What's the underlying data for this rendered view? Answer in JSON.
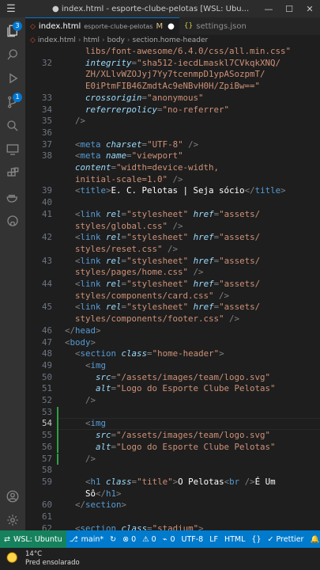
{
  "titlebar": {
    "title": "● index.html - esporte-clube-pelotas [WSL: Ubu...",
    "minimize": "—",
    "maximize": "☐",
    "close": "✕"
  },
  "activity": {
    "scm_badge": "3",
    "extensions_badge": "1"
  },
  "tabs": [
    {
      "label": "index.html",
      "path": "esporte-clube-pelotas",
      "status": "M",
      "dirty": "●"
    },
    {
      "label": "settings.json"
    }
  ],
  "breadcrumb": [
    "index.html",
    "html",
    "body",
    "section.home-header"
  ],
  "code_lines": [
    {
      "n": "",
      "tokens": [
        [
          "p",
          "    "
        ],
        [
          "str",
          "libs/font-awesome/6.4.0/css/all.min.css\""
        ]
      ]
    },
    {
      "n": "32",
      "tokens": [
        [
          "attr",
          "    integrity"
        ],
        [
          "p",
          "="
        ],
        [
          "str",
          "\"sha512-iecdLmaskl7CVkqkXNQ/"
        ]
      ]
    },
    {
      "n": "",
      "tokens": [
        [
          "str",
          "    ZH/XLlvWZOJyj7Yy7tcenmpD1ypASozpmT/"
        ]
      ]
    },
    {
      "n": "",
      "tokens": [
        [
          "str",
          "    E0iPtmFIB46ZmdtAc9eNBvH0H/ZpiBw==\""
        ]
      ]
    },
    {
      "n": "33",
      "tokens": [
        [
          "attr",
          "    crossorigin"
        ],
        [
          "p",
          "="
        ],
        [
          "str",
          "\"anonymous\""
        ]
      ]
    },
    {
      "n": "34",
      "tokens": [
        [
          "attr",
          "    referrerpolicy"
        ],
        [
          "p",
          "="
        ],
        [
          "str",
          "\"no-referrer\""
        ]
      ]
    },
    {
      "n": "35",
      "tokens": [
        [
          "p",
          "  />"
        ]
      ]
    },
    {
      "n": "36",
      "tokens": []
    },
    {
      "n": "37",
      "tokens": [
        [
          "p",
          "  <"
        ],
        [
          "tag",
          "meta"
        ],
        [
          "attr",
          " charset"
        ],
        [
          "p",
          "="
        ],
        [
          "str",
          "\"UTF-8\""
        ],
        [
          "p",
          " />"
        ]
      ]
    },
    {
      "n": "38",
      "tokens": [
        [
          "p",
          "  <"
        ],
        [
          "tag",
          "meta"
        ],
        [
          "attr",
          " name"
        ],
        [
          "p",
          "="
        ],
        [
          "str",
          "\"viewport\""
        ]
      ]
    },
    {
      "n": "",
      "tokens": [
        [
          "attr",
          "  content"
        ],
        [
          "p",
          "="
        ],
        [
          "str",
          "\"width=device-width,"
        ]
      ]
    },
    {
      "n": "",
      "tokens": [
        [
          "str",
          "  initial-scale=1.0\""
        ],
        [
          "p",
          " />"
        ]
      ]
    },
    {
      "n": "39",
      "tokens": [
        [
          "p",
          "  <"
        ],
        [
          "tag",
          "title"
        ],
        [
          "p",
          ">"
        ],
        [
          "g",
          "E. C. Pelotas | Seja sócio"
        ],
        [
          "p",
          "</"
        ],
        [
          "tag",
          "title"
        ],
        [
          "p",
          ">"
        ]
      ]
    },
    {
      "n": "40",
      "tokens": []
    },
    {
      "n": "41",
      "tokens": [
        [
          "p",
          "  <"
        ],
        [
          "tag",
          "link"
        ],
        [
          "attr",
          " rel"
        ],
        [
          "p",
          "="
        ],
        [
          "str",
          "\"stylesheet\""
        ],
        [
          "attr",
          " href"
        ],
        [
          "p",
          "="
        ],
        [
          "str",
          "\"assets/"
        ]
      ]
    },
    {
      "n": "",
      "tokens": [
        [
          "str",
          "  styles/global.css\""
        ],
        [
          "p",
          " />"
        ]
      ]
    },
    {
      "n": "42",
      "tokens": [
        [
          "p",
          "  <"
        ],
        [
          "tag",
          "link"
        ],
        [
          "attr",
          " rel"
        ],
        [
          "p",
          "="
        ],
        [
          "str",
          "\"stylesheet\""
        ],
        [
          "attr",
          " href"
        ],
        [
          "p",
          "="
        ],
        [
          "str",
          "\"assets/"
        ]
      ]
    },
    {
      "n": "",
      "tokens": [
        [
          "str",
          "  styles/reset.css\""
        ],
        [
          "p",
          " />"
        ]
      ]
    },
    {
      "n": "43",
      "tokens": [
        [
          "p",
          "  <"
        ],
        [
          "tag",
          "link"
        ],
        [
          "attr",
          " rel"
        ],
        [
          "p",
          "="
        ],
        [
          "str",
          "\"stylesheet\""
        ],
        [
          "attr",
          " href"
        ],
        [
          "p",
          "="
        ],
        [
          "str",
          "\"assets/"
        ]
      ]
    },
    {
      "n": "",
      "tokens": [
        [
          "str",
          "  styles/pages/home.css\""
        ],
        [
          "p",
          " />"
        ]
      ]
    },
    {
      "n": "44",
      "tokens": [
        [
          "p",
          "  <"
        ],
        [
          "tag",
          "link"
        ],
        [
          "attr",
          " rel"
        ],
        [
          "p",
          "="
        ],
        [
          "str",
          "\"stylesheet\""
        ],
        [
          "attr",
          " href"
        ],
        [
          "p",
          "="
        ],
        [
          "str",
          "\"assets/"
        ]
      ]
    },
    {
      "n": "",
      "tokens": [
        [
          "str",
          "  styles/components/card.css\""
        ],
        [
          "p",
          " />"
        ]
      ]
    },
    {
      "n": "45",
      "tokens": [
        [
          "p",
          "  <"
        ],
        [
          "tag",
          "link"
        ],
        [
          "attr",
          " rel"
        ],
        [
          "p",
          "="
        ],
        [
          "str",
          "\"stylesheet\""
        ],
        [
          "attr",
          " href"
        ],
        [
          "p",
          "="
        ],
        [
          "str",
          "\"assets/"
        ]
      ]
    },
    {
      "n": "",
      "tokens": [
        [
          "str",
          "  styles/components/footer.css\""
        ],
        [
          "p",
          " />"
        ]
      ]
    },
    {
      "n": "46",
      "tokens": [
        [
          "p",
          "</"
        ],
        [
          "tag",
          "head"
        ],
        [
          "p",
          ">"
        ]
      ]
    },
    {
      "n": "47",
      "tokens": [
        [
          "p",
          "<"
        ],
        [
          "tag",
          "body"
        ],
        [
          "p",
          ">"
        ]
      ]
    },
    {
      "n": "48",
      "tokens": [
        [
          "p",
          "  <"
        ],
        [
          "tag",
          "section"
        ],
        [
          "attr",
          " class"
        ],
        [
          "p",
          "="
        ],
        [
          "str",
          "\"home-header\""
        ],
        [
          "p",
          ">"
        ]
      ]
    },
    {
      "n": "49",
      "tokens": [
        [
          "p",
          "    <"
        ],
        [
          "tag",
          "img"
        ]
      ]
    },
    {
      "n": "50",
      "tokens": [
        [
          "attr",
          "      src"
        ],
        [
          "p",
          "="
        ],
        [
          "str",
          "\"/assets/images/team/logo.svg\""
        ]
      ]
    },
    {
      "n": "51",
      "tokens": [
        [
          "attr",
          "      alt"
        ],
        [
          "p",
          "="
        ],
        [
          "str",
          "\"Logo do Esporte Clube Pelotas\""
        ]
      ]
    },
    {
      "n": "52",
      "tokens": [
        [
          "p",
          "    />"
        ]
      ]
    },
    {
      "n": "53",
      "tokens": []
    },
    {
      "n": "54",
      "tokens": [
        [
          "p",
          "    <"
        ],
        [
          "tag",
          "img"
        ]
      ],
      "current": true
    },
    {
      "n": "55",
      "tokens": [
        [
          "attr",
          "      src"
        ],
        [
          "p",
          "="
        ],
        [
          "str",
          "\"/assets/images/team/logo.svg\""
        ]
      ]
    },
    {
      "n": "56",
      "tokens": [
        [
          "attr",
          "      alt"
        ],
        [
          "p",
          "="
        ],
        [
          "str",
          "\"Logo do Esporte Clube Pelotas\""
        ]
      ]
    },
    {
      "n": "57",
      "tokens": [
        [
          "p",
          "    />"
        ]
      ]
    },
    {
      "n": "58",
      "tokens": []
    },
    {
      "n": "59",
      "tokens": [
        [
          "p",
          "    <"
        ],
        [
          "tag",
          "h1"
        ],
        [
          "attr",
          " class"
        ],
        [
          "p",
          "="
        ],
        [
          "str",
          "\"title\""
        ],
        [
          "p",
          ">"
        ],
        [
          "g",
          "O Pelotas"
        ],
        [
          "p",
          "<"
        ],
        [
          "tag",
          "br"
        ],
        [
          "p",
          " />"
        ],
        [
          "g",
          "É Um"
        ]
      ]
    },
    {
      "n": "",
      "tokens": [
        [
          "g",
          "    Sô"
        ],
        [
          "p",
          "</"
        ],
        [
          "tag",
          "h1"
        ],
        [
          "p",
          ">"
        ]
      ]
    },
    {
      "n": "60",
      "tokens": [
        [
          "p",
          "  </"
        ],
        [
          "tag",
          "section"
        ],
        [
          "p",
          ">"
        ]
      ]
    },
    {
      "n": "61",
      "tokens": []
    },
    {
      "n": "62",
      "tokens": [
        [
          "p",
          "  <"
        ],
        [
          "tag",
          "section"
        ],
        [
          "attr",
          " class"
        ],
        [
          "p",
          "="
        ],
        [
          "str",
          "\"stadium\""
        ],
        [
          "p",
          ">"
        ]
      ]
    }
  ],
  "modified_lines": [
    "53",
    "54",
    "55",
    "56",
    "57"
  ],
  "statusbar": {
    "remote": "WSL: Ubuntu",
    "branch": "main*",
    "errors": "⊗ 0",
    "warnings": "⚠ 0",
    "ports": "0",
    "encoding": "UTF-8",
    "eol": "LF",
    "language": "HTML",
    "prettier": "✓ Prettier"
  },
  "taskbar": {
    "temperature": "14°C",
    "condition": "Pred ensolarado"
  },
  "colors": {
    "accent": "#007acc",
    "remote": "#16825d",
    "modified": "#2ea043"
  }
}
